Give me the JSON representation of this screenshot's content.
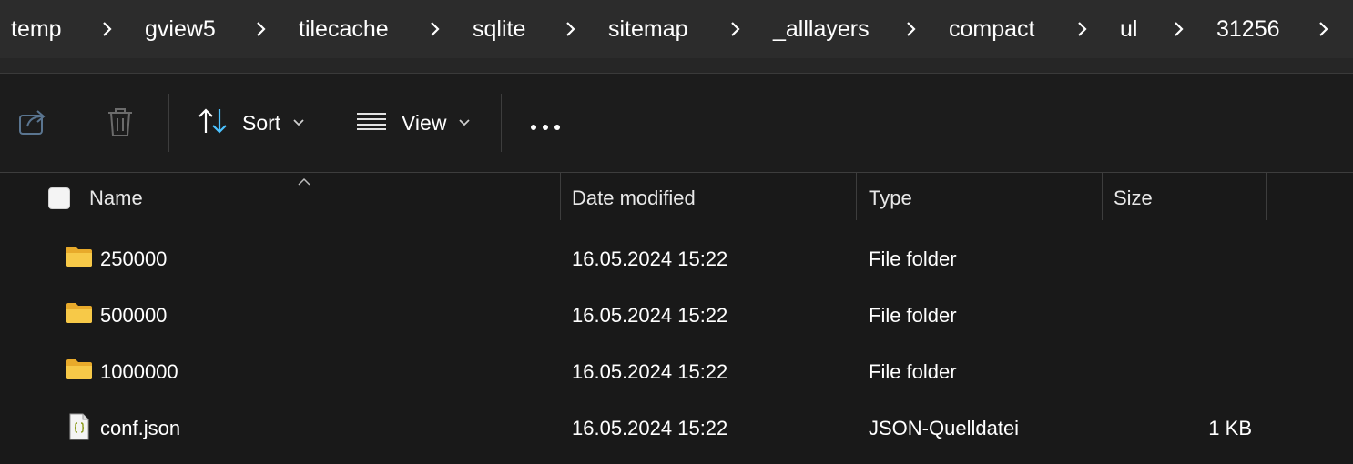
{
  "breadcrumb": [
    "temp",
    "gview5",
    "tilecache",
    "sqlite",
    "sitemap",
    "_alllayers",
    "compact",
    "ul",
    "31256"
  ],
  "toolbar": {
    "share_icon": "share-icon",
    "delete_icon": "trash-icon",
    "sort_label": "Sort",
    "view_label": "View",
    "more_icon": "more-icon"
  },
  "columns": {
    "name": "Name",
    "date": "Date modified",
    "type": "Type",
    "size": "Size"
  },
  "files": [
    {
      "name": "250000",
      "date": "16.05.2024 15:22",
      "type": "File folder",
      "size": "",
      "icon": "folder-icon"
    },
    {
      "name": "500000",
      "date": "16.05.2024 15:22",
      "type": "File folder",
      "size": "",
      "icon": "folder-icon"
    },
    {
      "name": "1000000",
      "date": "16.05.2024 15:22",
      "type": "File folder",
      "size": "",
      "icon": "folder-icon"
    },
    {
      "name": "conf.json",
      "date": "16.05.2024 15:22",
      "type": "JSON-Quelldatei",
      "size": "1 KB",
      "icon": "json-file-icon"
    }
  ],
  "colors": {
    "background": "#191919",
    "breadcrumb_bar": "#2c2c2c",
    "folder": "#f7c948",
    "accent": "#4cc2ff"
  }
}
